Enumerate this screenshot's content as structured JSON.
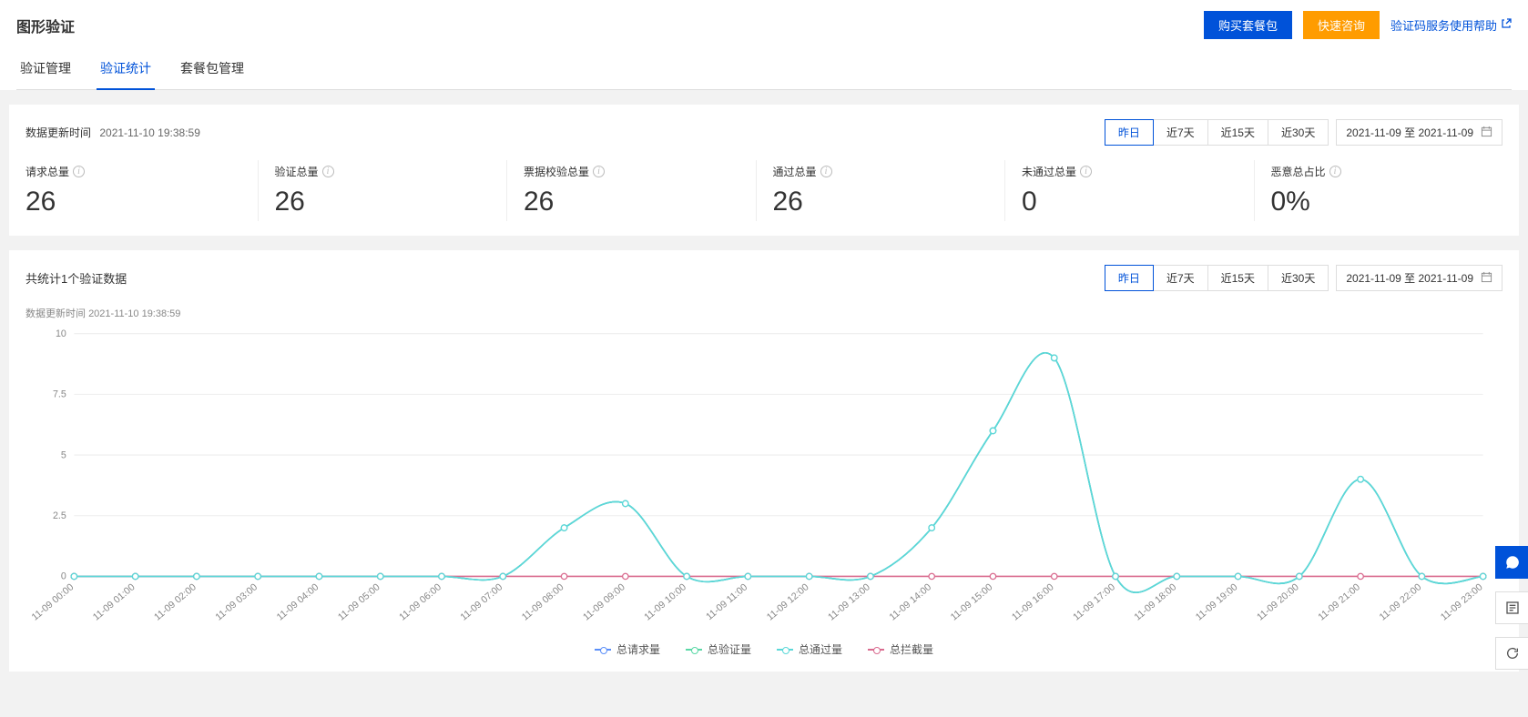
{
  "header": {
    "title": "图形验证",
    "buy_label": "购买套餐包",
    "consult_label": "快速咨询",
    "help_label": "验证码服务使用帮助"
  },
  "tabs": {
    "manage": "验证管理",
    "stats": "验证统计",
    "package": "套餐包管理"
  },
  "update_time": {
    "label": "数据更新时间",
    "value": "2021-11-10 19:38:59"
  },
  "range_buttons": {
    "yesterday": "昨日",
    "d7": "近7天",
    "d15": "近15天",
    "d30": "近30天"
  },
  "date_range_text": "2021-11-09 至 2021-11-09",
  "stats": [
    {
      "label": "请求总量",
      "value": "26"
    },
    {
      "label": "验证总量",
      "value": "26"
    },
    {
      "label": "票据校验总量",
      "value": "26"
    },
    {
      "label": "通过总量",
      "value": "26"
    },
    {
      "label": "未通过总量",
      "value": "0"
    },
    {
      "label": "恶意总占比",
      "value": "0%"
    }
  ],
  "chart_section_title": "共统计1个验证数据",
  "legend": {
    "req": "总请求量",
    "verify": "总验证量",
    "pass": "总通过量",
    "block": "总拦截量"
  },
  "colors": {
    "req": "#5b8ff9",
    "verify": "#5ad8a6",
    "pass": "#5bd8d8",
    "block": "#d96b8f"
  },
  "chart_data": {
    "type": "line",
    "ylim": [
      0,
      10
    ],
    "yticks": [
      0,
      2.5,
      5,
      7.5,
      10
    ],
    "categories": [
      "11-09 00:00",
      "11-09 01:00",
      "11-09 02:00",
      "11-09 03:00",
      "11-09 04:00",
      "11-09 05:00",
      "11-09 06:00",
      "11-09 07:00",
      "11-09 08:00",
      "11-09 09:00",
      "11-09 10:00",
      "11-09 11:00",
      "11-09 12:00",
      "11-09 13:00",
      "11-09 14:00",
      "11-09 15:00",
      "11-09 16:00",
      "11-09 17:00",
      "11-09 18:00",
      "11-09 19:00",
      "11-09 20:00",
      "11-09 21:00",
      "11-09 22:00",
      "11-09 23:00"
    ],
    "series": [
      {
        "name": "总请求量",
        "key": "req",
        "values": [
          0,
          0,
          0,
          0,
          0,
          0,
          0,
          0,
          2,
          3,
          0,
          0,
          0,
          0,
          2,
          6,
          9,
          0,
          0,
          0,
          0,
          4,
          0,
          0
        ]
      },
      {
        "name": "总验证量",
        "key": "verify",
        "values": [
          0,
          0,
          0,
          0,
          0,
          0,
          0,
          0,
          2,
          3,
          0,
          0,
          0,
          0,
          2,
          6,
          9,
          0,
          0,
          0,
          0,
          4,
          0,
          0
        ]
      },
      {
        "name": "总通过量",
        "key": "pass",
        "values": [
          0,
          0,
          0,
          0,
          0,
          0,
          0,
          0,
          2,
          3,
          0,
          0,
          0,
          0,
          2,
          6,
          9,
          0,
          0,
          0,
          0,
          4,
          0,
          0
        ]
      },
      {
        "name": "总拦截量",
        "key": "block",
        "values": [
          0,
          0,
          0,
          0,
          0,
          0,
          0,
          0,
          0,
          0,
          0,
          0,
          0,
          0,
          0,
          0,
          0,
          0,
          0,
          0,
          0,
          0,
          0,
          0
        ]
      }
    ]
  }
}
